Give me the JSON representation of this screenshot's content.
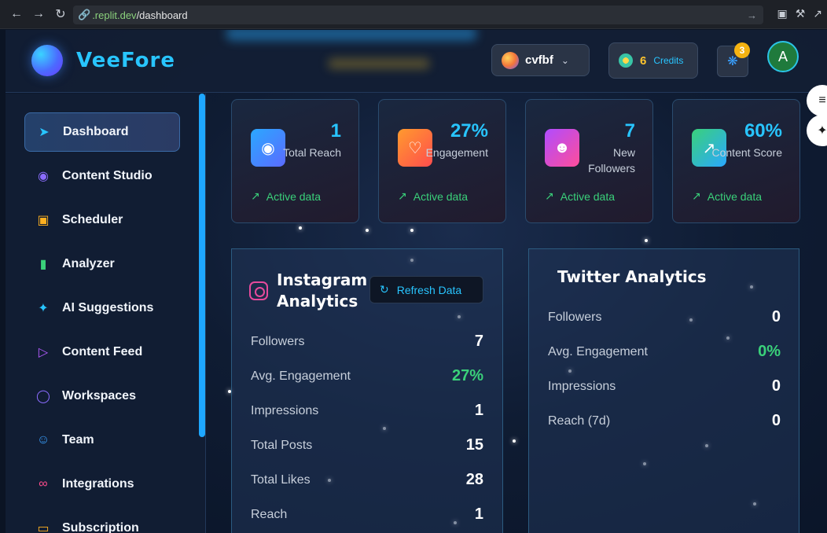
{
  "browser": {
    "url_domain": ".replit.dev",
    "url_path": "/dashboard"
  },
  "header": {
    "logo": "VeeFore",
    "workspace": "cvfbf",
    "credits_count": "6",
    "credits_label": "Credits",
    "notification_count": "3",
    "avatar_letter": "A"
  },
  "sidebar": {
    "items": [
      {
        "label": "Dashboard",
        "icon": "rocket-icon",
        "color": "#28c5ff"
      },
      {
        "label": "Content Studio",
        "icon": "palette-icon",
        "color": "#8b6cff"
      },
      {
        "label": "Scheduler",
        "icon": "calendar-icon",
        "color": "#ffb020"
      },
      {
        "label": "Analyzer",
        "icon": "bar-chart-icon",
        "color": "#3ad17a"
      },
      {
        "label": "AI Suggestions",
        "icon": "sparkles-icon",
        "color": "#28c5ff"
      },
      {
        "label": "Content Feed",
        "icon": "play-circle-icon",
        "color": "#b45cff"
      },
      {
        "label": "Workspaces",
        "icon": "globe-icon",
        "color": "#8b6cff"
      },
      {
        "label": "Team",
        "icon": "users-icon",
        "color": "#3aa0ff"
      },
      {
        "label": "Integrations",
        "icon": "link-icon",
        "color": "#ff4d8d"
      },
      {
        "label": "Subscription",
        "icon": "card-icon",
        "color": "#ffb020"
      }
    ]
  },
  "stats": [
    {
      "value": "1",
      "label": "Total Reach",
      "foot": "Active data",
      "icon": "eye-icon",
      "gradient": [
        "#2aa8ff",
        "#5b6bff"
      ]
    },
    {
      "value": "27%",
      "label": "Engagement",
      "foot": "Active data",
      "icon": "heart-icon",
      "gradient": [
        "#ff9a2e",
        "#ff4d4d"
      ]
    },
    {
      "value": "7",
      "label": "New Followers",
      "foot": "Active data",
      "icon": "users-icon",
      "gradient": [
        "#b04cff",
        "#ff4d9a"
      ]
    },
    {
      "value": "60%",
      "label": "Content Score",
      "foot": "Active data",
      "icon": "trending-up-icon",
      "gradient": [
        "#3ad17a",
        "#2aa8ff"
      ]
    }
  ],
  "instagram": {
    "title_line1": "Instagram",
    "title_line2": "Analytics",
    "refresh_label": "Refresh Data",
    "rows": [
      {
        "label": "Followers",
        "value": "7",
        "green": false
      },
      {
        "label": "Avg. Engagement",
        "value": "27%",
        "green": true
      },
      {
        "label": "Impressions",
        "value": "1",
        "green": false
      },
      {
        "label": "Total Posts",
        "value": "15",
        "green": false
      },
      {
        "label": "Total Likes",
        "value": "28",
        "green": false
      },
      {
        "label": "Reach",
        "value": "1",
        "green": false
      }
    ]
  },
  "twitter": {
    "title": "Twitter Analytics",
    "rows": [
      {
        "label": "Followers",
        "value": "0",
        "green": false
      },
      {
        "label": "Avg. Engagement",
        "value": "0%",
        "green": true
      },
      {
        "label": "Impressions",
        "value": "0",
        "green": false
      },
      {
        "label": "Reach (7d)",
        "value": "0",
        "green": false
      }
    ]
  }
}
